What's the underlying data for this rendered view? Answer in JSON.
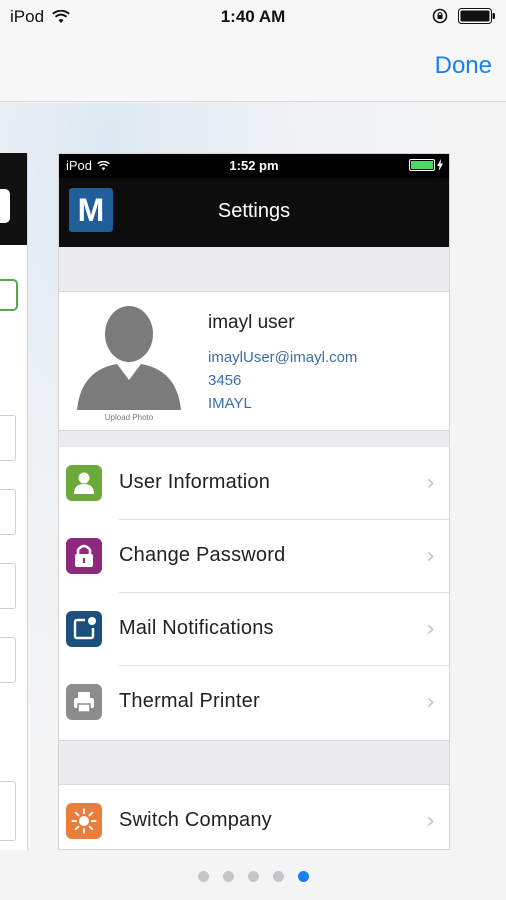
{
  "status_bar": {
    "carrier": "iPod",
    "time": "1:40 AM",
    "icons": [
      "wifi-icon",
      "orientation-lock-icon",
      "battery-icon"
    ]
  },
  "nav": {
    "done_label": "Done",
    "accent": "#1a7ff0"
  },
  "screenshot": {
    "status": {
      "carrier": "iPod",
      "time": "1:52 pm",
      "battery_color": "#4cd964"
    },
    "header": {
      "logo_letter": "M",
      "title": "Settings",
      "logo_color": "#1f5e9a"
    },
    "profile": {
      "upload_label": "Upload Photo",
      "name": "imayl user",
      "email": "imaylUser@imayl.com",
      "id": "3456",
      "company": "IMAYL"
    },
    "menu": [
      {
        "label": "User Information",
        "icon": "user-icon",
        "color": "#6aa93a"
      },
      {
        "label": "Change Password",
        "icon": "lock-icon",
        "color": "#8e2a7e"
      },
      {
        "label": "Mail Notifications",
        "icon": "notification-icon",
        "color": "#1b4f7c"
      },
      {
        "label": "Thermal Printer",
        "icon": "printer-icon",
        "color": "#8c8c8c"
      }
    ],
    "menu2": [
      {
        "label": "Switch Company",
        "icon": "sun-icon",
        "color": "#ea7d3c"
      }
    ]
  },
  "pager": {
    "total": 5,
    "active_index": 4
  }
}
